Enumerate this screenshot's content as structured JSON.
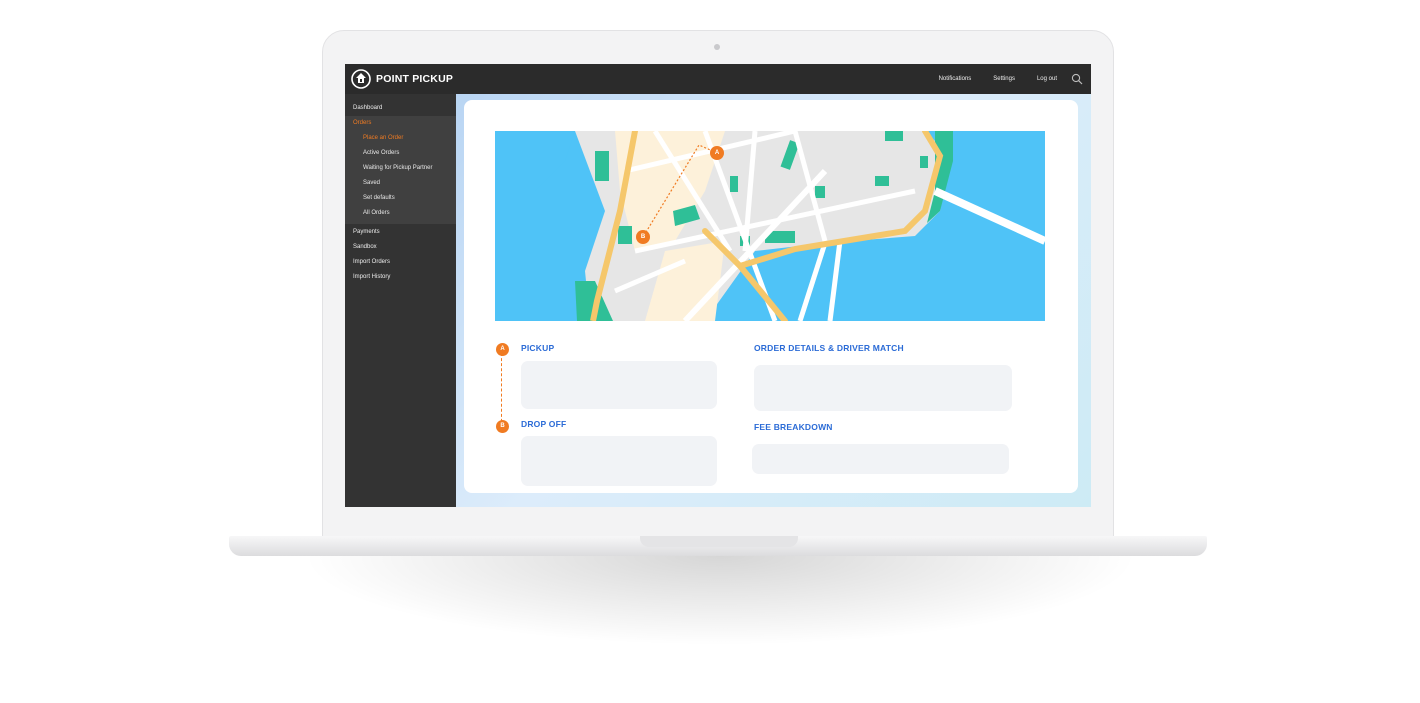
{
  "app": {
    "brand": "POINT PICKUP"
  },
  "topbar": {
    "links": [
      "Notifications",
      "Settings",
      "Log out"
    ],
    "search_icon": "search-icon"
  },
  "sidebar": {
    "items_top": [
      "Dashboard"
    ],
    "orders": {
      "label": "Orders",
      "children": [
        "Place an Order",
        "Active Orders",
        "Waiting for Pickup Partner",
        "Saved",
        "Set defaults",
        "All Orders"
      ],
      "active_child": "Place an Order"
    },
    "items_bottom": [
      "Payments",
      "Sandbox",
      "Import Orders",
      "Import History"
    ]
  },
  "map": {
    "marker_a": "A",
    "marker_b": "B"
  },
  "sections": {
    "pickup": "PICKUP",
    "drop_off": "DROP OFF",
    "order_details": "ORDER DETAILS & DRIVER MATCH",
    "fee_breakdown": "FEE BREAKDOWN"
  },
  "colors": {
    "accent": "#f07b22",
    "heading_blue": "#2b6bd6",
    "water": "#4fc3f7",
    "park": "#2fbf97",
    "road_major": "#f5c76b"
  }
}
